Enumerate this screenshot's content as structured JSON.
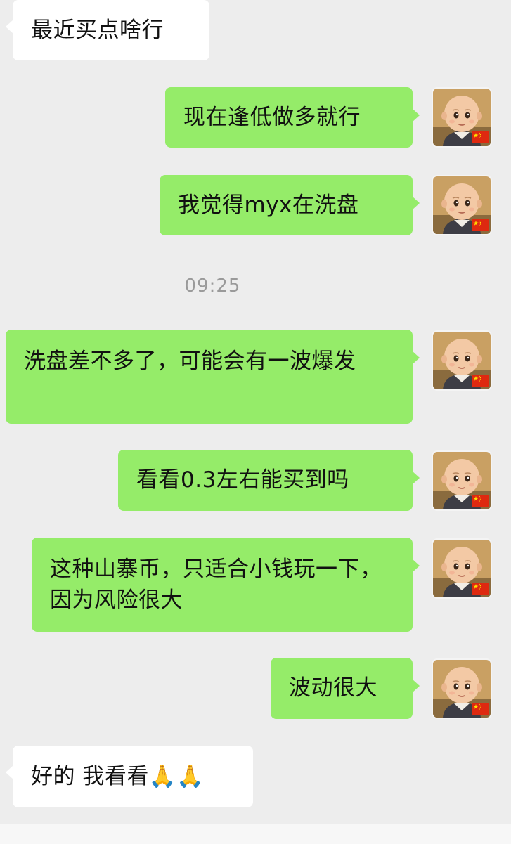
{
  "messages": [
    {
      "text": "最近买点啥行",
      "direction": "incoming"
    },
    {
      "text": "现在逢低做多就行",
      "direction": "outgoing"
    },
    {
      "text": "我觉得myx在洗盘",
      "direction": "outgoing"
    },
    {
      "text": "洗盘差不多了，可能会有一波爆发",
      "direction": "outgoing"
    },
    {
      "text": "看看0.3左右能买到吗",
      "direction": "outgoing"
    },
    {
      "text": "这种山寨币，只适合小钱玩一下，因为风险很大",
      "direction": "outgoing"
    },
    {
      "text": "波动很大",
      "direction": "outgoing"
    },
    {
      "text": "好的 我看看🙏🙏",
      "direction": "incoming"
    }
  ],
  "timestamp": "09:25",
  "avatar_icon": "cartoon-monk-avatar-icon",
  "flag_icon": "china-flag-icon",
  "colors": {
    "background": "#ededed",
    "outgoing_bubble": "#95ec69",
    "incoming_bubble": "#ffffff",
    "timestamp_text": "#9a9a9a"
  }
}
